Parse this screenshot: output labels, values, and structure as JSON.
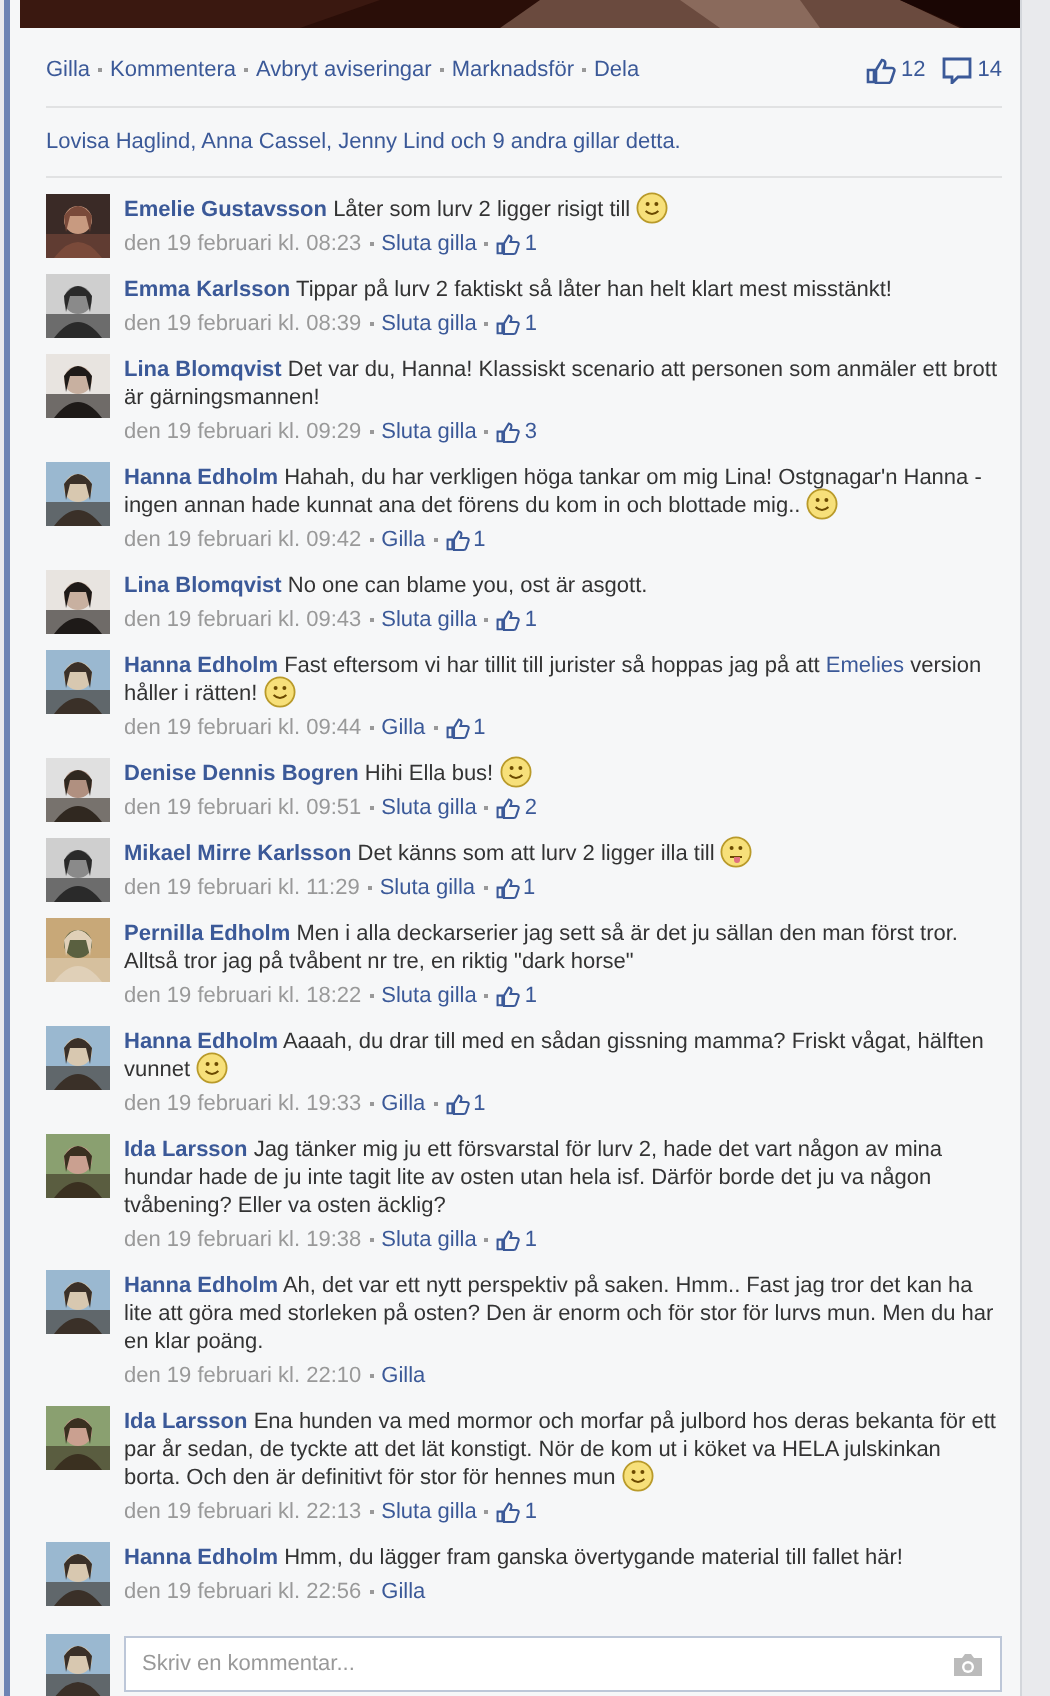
{
  "actions": [
    "Gilla",
    "Kommentera",
    "Avbryt aviseringar",
    "Marknadsför",
    "Dela"
  ],
  "counts": {
    "likes": "12",
    "comments": "14"
  },
  "likes_summary": "Lovisa Haglind, Anna Cassel, Jenny Lind och 9 andra gillar detta.",
  "comments": [
    {
      "author": "Emelie Gustavsson",
      "body": [
        {
          "kind": "text",
          "text": "Låter som lurv 2 ligger risigt till"
        },
        {
          "kind": "smile"
        }
      ],
      "time": "den 19 februari kl. 08:23",
      "like_action": "Sluta gilla",
      "likes": "1"
    },
    {
      "author": "Emma Karlsson",
      "body": [
        {
          "kind": "text",
          "text": "Tippar på lurv 2 faktiskt så låter han helt klart mest misstänkt!"
        }
      ],
      "time": "den 19 februari kl. 08:39",
      "like_action": "Sluta gilla",
      "likes": "1"
    },
    {
      "author": "Lina Blomqvist",
      "body": [
        {
          "kind": "text",
          "text": "Det var du, Hanna! Klassiskt scenario att personen som anmäler ett brott är gärningsmannen!"
        }
      ],
      "time": "den 19 februari kl. 09:29",
      "like_action": "Sluta gilla",
      "likes": "3"
    },
    {
      "author": "Hanna Edholm",
      "body": [
        {
          "kind": "text",
          "text": "Hahah, du har verkligen höga tankar om mig Lina! Ostgnagar'n Hanna - ingen annan hade kunnat ana det förens du kom in och blottade mig.."
        },
        {
          "kind": "smile"
        }
      ],
      "time": "den 19 februari kl. 09:42",
      "like_action": "Gilla",
      "likes": "1"
    },
    {
      "author": "Lina Blomqvist",
      "body": [
        {
          "kind": "text",
          "text": "No one can blame you, ost är asgott."
        }
      ],
      "time": "den 19 februari kl. 09:43",
      "like_action": "Sluta gilla",
      "likes": "1"
    },
    {
      "author": "Hanna Edholm",
      "body": [
        {
          "kind": "text",
          "text": "Fast eftersom vi har tillit till jurister så hoppas jag på att"
        },
        {
          "kind": "link",
          "text": "Emelies"
        },
        {
          "kind": "text",
          "text": "version håller i rätten!"
        },
        {
          "kind": "smile"
        }
      ],
      "time": "den 19 februari kl. 09:44",
      "like_action": "Gilla",
      "likes": "1"
    },
    {
      "author": "Denise Dennis Bogren",
      "body": [
        {
          "kind": "text",
          "text": "Hihi Ella bus!"
        },
        {
          "kind": "smile"
        }
      ],
      "time": "den 19 februari kl. 09:51",
      "like_action": "Sluta gilla",
      "likes": "2"
    },
    {
      "author": "Mikael Mirre Karlsson",
      "body": [
        {
          "kind": "text",
          "text": "Det känns som att lurv 2 ligger illa till"
        },
        {
          "kind": "tongue"
        }
      ],
      "time": "den 19 februari kl. 11:29",
      "like_action": "Sluta gilla",
      "likes": "1"
    },
    {
      "author": "Pernilla Edholm",
      "body": [
        {
          "kind": "text",
          "text": "Men i alla deckarserier jag sett så är det ju sällan den man först tror. Alltså tror jag på tvåbent nr tre, en riktig \"dark horse\""
        }
      ],
      "time": "den 19 februari kl. 18:22",
      "like_action": "Sluta gilla",
      "likes": "1"
    },
    {
      "author": "Hanna Edholm",
      "body": [
        {
          "kind": "text",
          "text": "Aaaah, du drar till med en sådan gissning mamma? Friskt vågat, hälften vunnet"
        },
        {
          "kind": "smile"
        }
      ],
      "time": "den 19 februari kl. 19:33",
      "like_action": "Gilla",
      "likes": "1"
    },
    {
      "author": "Ida Larsson",
      "body": [
        {
          "kind": "text",
          "text": "Jag tänker mig ju ett försvarstal för lurv 2, hade det vart någon av mina hundar hade de ju inte tagit lite av osten utan hela isf. Därför borde det ju va någon tvåbening? Eller va osten äcklig?"
        }
      ],
      "time": "den 19 februari kl. 19:38",
      "like_action": "Sluta gilla",
      "likes": "1"
    },
    {
      "author": "Hanna Edholm",
      "body": [
        {
          "kind": "text",
          "text": "Ah, det var ett nytt perspektiv på saken. Hmm.. Fast jag tror det kan ha lite att göra med storleken på osten? Den är enorm och för stor för lurvs mun. Men du har en klar poäng."
        }
      ],
      "time": "den 19 februari kl. 22:10",
      "like_action": "Gilla"
    },
    {
      "author": "Ida Larsson",
      "body": [
        {
          "kind": "text",
          "text": "Ena hunden va med mormor och morfar på julbord hos deras bekanta för ett par år sedan, de tyckte att det lät konstigt. Nör de kom ut i köket va HELA julskinkan borta. Och den är definitivt för stor för hennes mun"
        },
        {
          "kind": "smile"
        }
      ],
      "time": "den 19 februari kl. 22:13",
      "like_action": "Sluta gilla",
      "likes": "1"
    },
    {
      "author": "Hanna Edholm",
      "body": [
        {
          "kind": "text",
          "text": "Hmm, du lägger fram ganska övertygande material till fallet här!"
        }
      ],
      "time": "den 19 februari kl. 22:56",
      "like_action": "Gilla"
    }
  ],
  "composer": {
    "placeholder": "Skriv en kommentar..."
  }
}
